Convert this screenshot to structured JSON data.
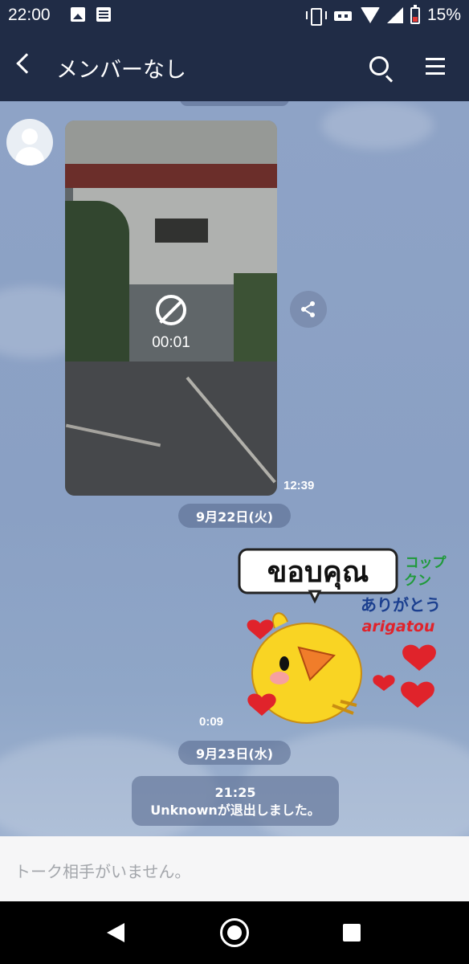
{
  "status_bar": {
    "time": "22:00",
    "battery": "15%",
    "icons": [
      "image-notification-icon",
      "message-notification-icon",
      "vibrate-icon",
      "robot-icon",
      "wifi-icon",
      "signal-icon",
      "battery-icon"
    ]
  },
  "header": {
    "title": "メンバーなし",
    "icons": [
      "back-arrow-icon",
      "search-icon",
      "menu-icon"
    ]
  },
  "chat": {
    "video_message": {
      "duration": "00:01",
      "time": "12:39",
      "icons": [
        "blocked-icon",
        "share-icon"
      ]
    },
    "date_1": "9月22日(火)",
    "sticker_message": {
      "time": "0:09",
      "sticker_text": [
        "ขอบคุณ",
        "コップ",
        "クン",
        "ありがとう",
        "arigatou"
      ]
    },
    "date_2": "9月23日(水)",
    "system_message": {
      "time": "21:25",
      "text": "Unknownが退出しました。"
    }
  },
  "input": {
    "placeholder": "トーク相手がいません。"
  },
  "colors": {
    "header_bg": "#202c46",
    "chat_bg": "#8ea3c6",
    "pill_bg": "#5a6c91",
    "heart_red": "#e0232b",
    "chick_yellow": "#f9d423"
  }
}
